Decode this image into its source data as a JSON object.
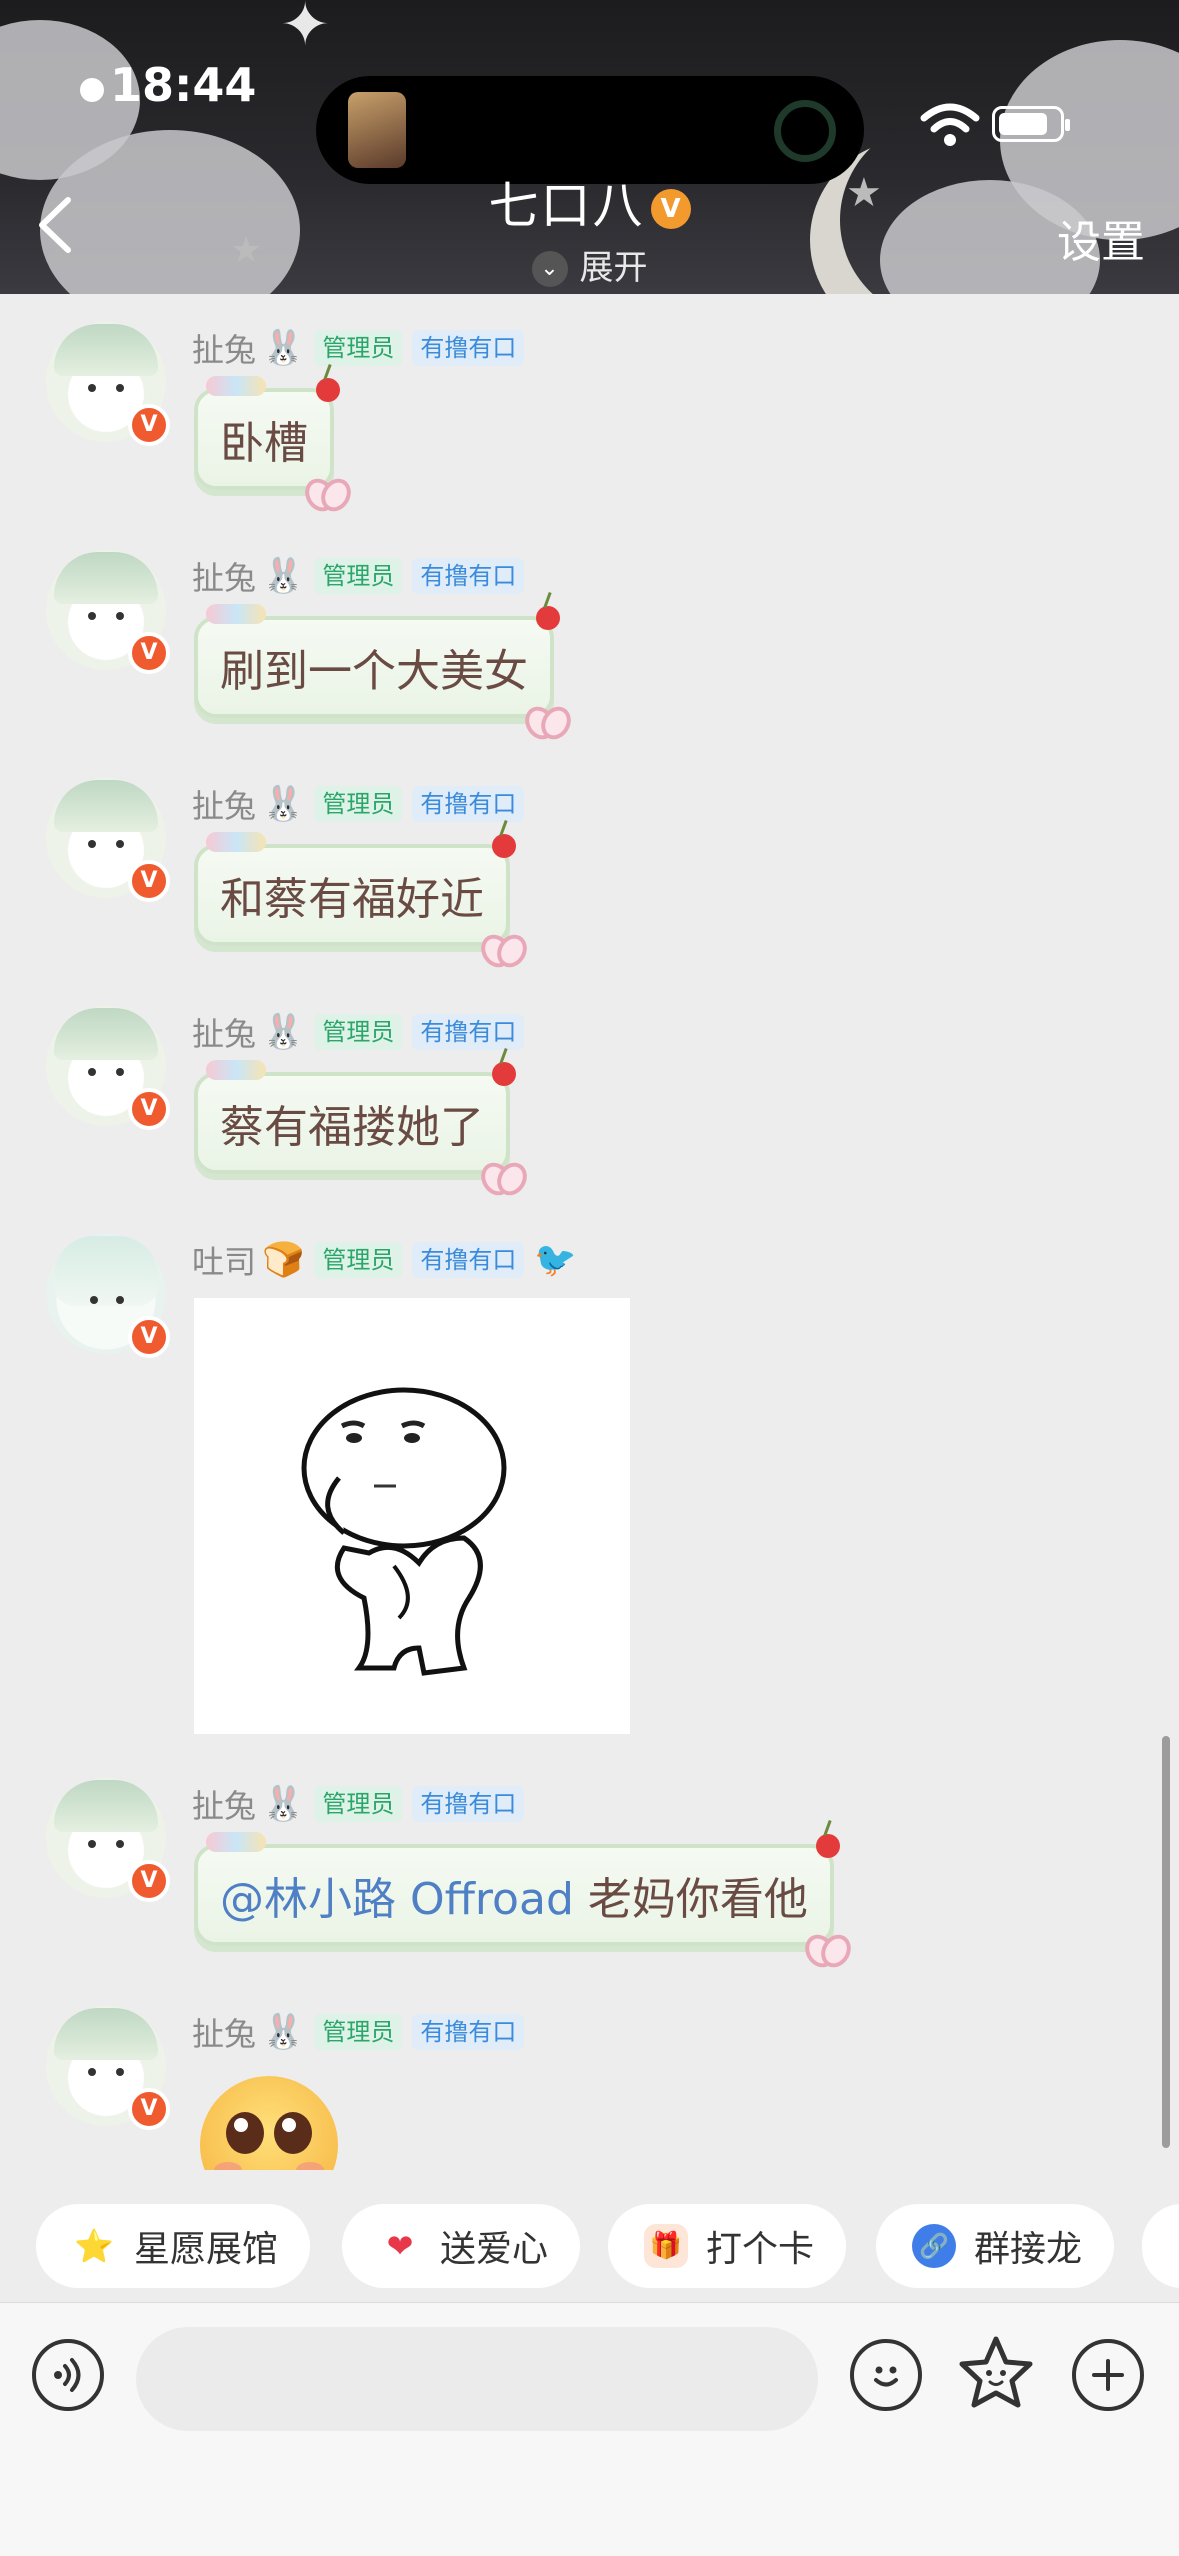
{
  "status_bar": {
    "time": "18:44"
  },
  "header": {
    "title": "七口八",
    "badge": "V",
    "expand_label": "展开",
    "settings_label": "设置"
  },
  "tags": {
    "admin": "管理员",
    "group": "有撸有口"
  },
  "messages": [
    {
      "sender": "扯兔",
      "emoji": "🐰",
      "text": "卧槽"
    },
    {
      "sender": "扯兔",
      "emoji": "🐰",
      "text": "刷到一个大美女"
    },
    {
      "sender": "扯兔",
      "emoji": "🐰",
      "text": "和蔡有福好近"
    },
    {
      "sender": "扯兔",
      "emoji": "🐰",
      "text": "蔡有福搂她了"
    },
    {
      "sender": "吐司",
      "emoji": "🍞",
      "extra_icon": "🐦",
      "type": "sticker"
    },
    {
      "sender": "扯兔",
      "emoji": "🐰",
      "mention": "@林小路 Offroad",
      "text": "老妈你看他"
    },
    {
      "sender": "扯兔",
      "emoji": "🐰",
      "type": "emoji"
    }
  ],
  "quick_actions": [
    {
      "label": "星愿展馆",
      "icon": "⭐"
    },
    {
      "label": "送爱心",
      "icon": "❤"
    },
    {
      "label": "打个卡",
      "icon": "🎁"
    },
    {
      "label": "群接龙",
      "icon": "🔗"
    }
  ],
  "colors": {
    "admin_tag": "#2aa66a",
    "group_tag": "#3b8bdc",
    "bubble_text": "#6a4b44",
    "mention": "#4f7fc4"
  }
}
